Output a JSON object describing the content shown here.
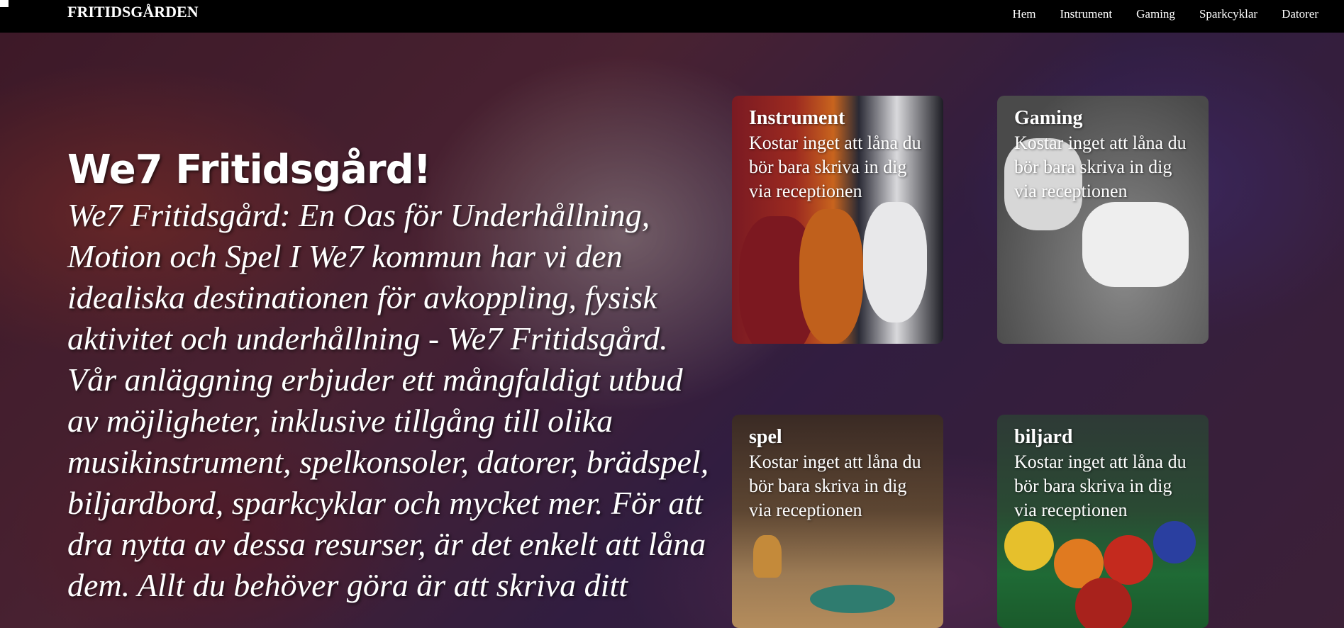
{
  "navbar": {
    "brand": "FRITIDSGÅRDEN",
    "links": [
      "Hem",
      "Instrument",
      "Gaming",
      "Sparkcyklar",
      "Datorer"
    ]
  },
  "hero": {
    "title": "We7 Fritidsgård!",
    "text": "We7 Fritidsgård: En Oas för Underhållning, Motion och Spel I We7 kommun har vi den idealiska destinationen för avkoppling, fysisk aktivitet och underhållning - We7 Fritidsgård. Vår anläggning erbjuder ett mångfaldigt utbud av möjligheter, inklusive tillgång till olika musikinstrument, spelkonsoler, datorer, brädspel, biljardbord, sparkcyklar och mycket mer. För att dra nytta av dessa resurser, är det enkelt att låna dem. Allt du behöver göra är att skriva ditt"
  },
  "cards": [
    {
      "title": "Instrument",
      "text": "Kostar inget att låna du bör bara skriva in dig via receptionen"
    },
    {
      "title": "Gaming",
      "text": "Kostar inget att låna du bör bara skriva in dig via receptionen"
    },
    {
      "title": "spel",
      "text": "Kostar inget att låna du bör bara skriva in dig via receptionen"
    },
    {
      "title": "biljard",
      "text": "Kostar inget att låna du bör bara skriva in dig via receptionen"
    }
  ],
  "colors": {
    "navbar_bg": "#000000",
    "text": "#ffffff"
  }
}
